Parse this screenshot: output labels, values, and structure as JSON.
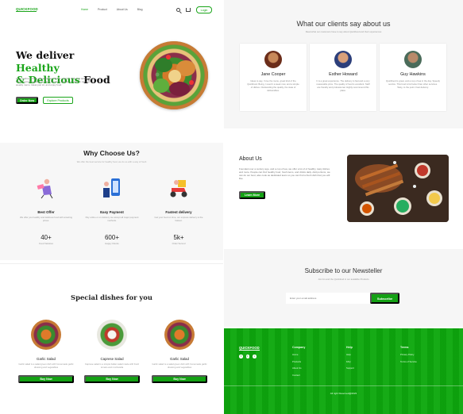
{
  "colors": {
    "brand_green": "#1aa51a",
    "footer_green": "#0ea80e",
    "text_dark": "#222222"
  },
  "hero": {
    "logo": "QUICKFOOD",
    "nav": [
      "Home",
      "Product",
      "About Us",
      "Blog"
    ],
    "login_label": "Login",
    "headline_part1": "We deliver",
    "headline_accent1": "Healthy",
    "headline_accent2": "& Delicious",
    "headline_part2": "Food",
    "description": "Order online to have a healthy tasty dinner ready to chill, and delivered the freshest green ingredients, while stressing the day or ready to own our weekly menu. Ideas just sit, and enjoy food.",
    "order_now_label": "Order Now",
    "explore_label": "Explore Products"
  },
  "testimonials": {
    "title": "What our clients say about us",
    "subtitle": "Read what our customers have to say about Quickfood and their experiences",
    "clients": [
      {
        "name": "Jane Cooper",
        "text": "Ideas to pay, I love the menu, great kind of the Quickfood. Being, I used it a week now, and a simple of dishes. Outstanding the quality, the state of deliverables.",
        "avatar_color": "#a0522d"
      },
      {
        "name": "Esther Howard",
        "text": "It is a great experience. The delivery is fast and a very reasonable price. The quality of food is excellent. Staff are friendly and professional. Highly recommend this place.",
        "avatar_color": "#2c3e7a"
      },
      {
        "name": "Guy Hawkins",
        "text": "Quickfood is great, and a cup of tea in the day. Speedy service. This food is far better than other services. Tasty, to the point. Fast delivery.",
        "avatar_color": "#4a6b5a"
      }
    ]
  },
  "why": {
    "title": "Why Choose Us?",
    "subtitle": "We offer the best service for healthy food, we do so with a way of fresh",
    "features": [
      {
        "title": "Best Offer",
        "desc": "We offer you healthy and delicious food with amazing prices.",
        "stat": "40+",
        "stat_label": "Food Varieties",
        "icon": "person-offer-icon"
      },
      {
        "title": "Easy Payment",
        "desc": "Pay online or on delivery we accept all major payment methods.",
        "stat": "600+",
        "stat_label": "Happy Clients",
        "icon": "mobile-payment-icon"
      },
      {
        "title": "Fastest delivery",
        "desc": "Get your food on time, our express delivery is the fastest.",
        "stat": "5k+",
        "stat_label": "Order Served",
        "icon": "delivery-scooter-icon"
      }
    ]
  },
  "about": {
    "title": "About Us",
    "text": "Founded over a century ago, and a cup of tea, we offer a lot of of healthy, tasty dishes and more. People can find healthy food, fresh items, and drinks daily. Add portions, we can do our best, also cook as dedicated team so you can find a fresh dish that you will like.",
    "button_label": "Learn More"
  },
  "dishes": {
    "title": "Special dishes for you",
    "items": [
      {
        "name": "Garlic Salad",
        "desc": "Garlic salad is a salad green dish with homemade garlic dressing and vegetables",
        "button": "Buy Now"
      },
      {
        "name": "Caprese Salad",
        "desc": "Caprese salad is a simple Italian salad made with fresh tomato and mozzarella",
        "button": "Buy Now"
      },
      {
        "name": "Garlic Salad",
        "desc": "Garlic salad is a salad green dish with homemade garlic dressing and vegetables",
        "button": "Buy Now"
      }
    ]
  },
  "newsletter": {
    "title": "Subscribe to our Newsteller",
    "subtitle": "Join Us and the Quickfood in our available Products",
    "placeholder": "Enter your email address",
    "button_label": "Subscribe"
  },
  "footer": {
    "logo": "QUICKFOOD",
    "social_icons": [
      "facebook-icon",
      "twitter-icon",
      "instagram-icon"
    ],
    "columns": [
      {
        "title": "Company",
        "links": [
          "Home",
          "Products",
          "About Us",
          "Contact"
        ]
      },
      {
        "title": "Help",
        "links": [
          "Help",
          "FAQ",
          "Support"
        ]
      },
      {
        "title": "Terms",
        "links": [
          "Privacy Policy",
          "Terms of Service"
        ]
      }
    ],
    "copyright": "All right Reserved@2023"
  }
}
